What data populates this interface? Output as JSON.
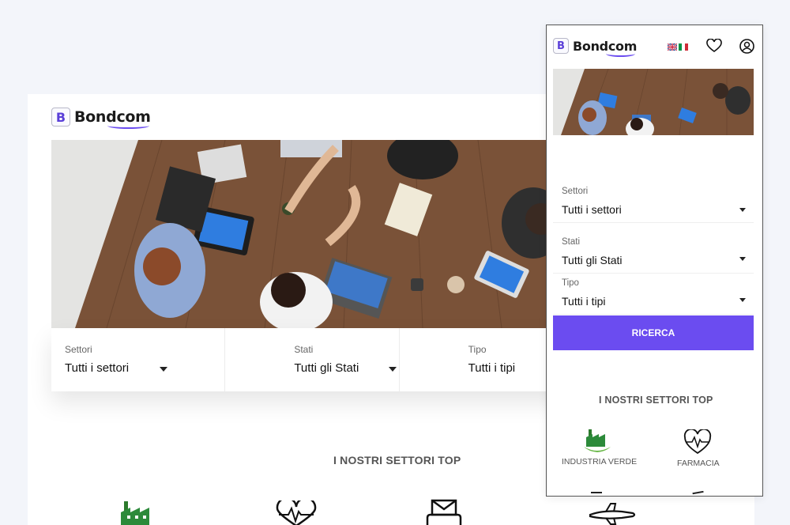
{
  "brand": {
    "logo_letter": "B",
    "name": "Bondcom",
    "accent": "#6b4cf0"
  },
  "desktop": {
    "search": {
      "fields": [
        {
          "label": "Settori",
          "value": "Tutti i settori"
        },
        {
          "label": "Stati",
          "value": "Tutti gli Stati"
        },
        {
          "label": "Tipo",
          "value": "Tutti i tipi"
        }
      ]
    },
    "sectors_title": "I NOSTRI SETTORI TOP",
    "sector_icons": [
      "factory-icon",
      "heartbeat-icon",
      "mail-icon",
      "airplane-icon"
    ]
  },
  "mobile": {
    "header_icons": [
      "flag-uk-icon",
      "flag-it-icon",
      "heart-icon",
      "user-icon"
    ],
    "search": {
      "fields": [
        {
          "label": "Settori",
          "value": "Tutti i settori"
        },
        {
          "label": "Stati",
          "value": "Tutti gli Stati"
        },
        {
          "label": "Tipo",
          "value": "Tutti i tipi"
        }
      ],
      "button_label": "RICERCA"
    },
    "sectors_title": "I NOSTRI SETTORI TOP",
    "sectors": [
      {
        "label": "INDUSTRIA VERDE",
        "icon": "factory-icon"
      },
      {
        "label": "FARMACIA",
        "icon": "heartbeat-icon"
      }
    ]
  }
}
